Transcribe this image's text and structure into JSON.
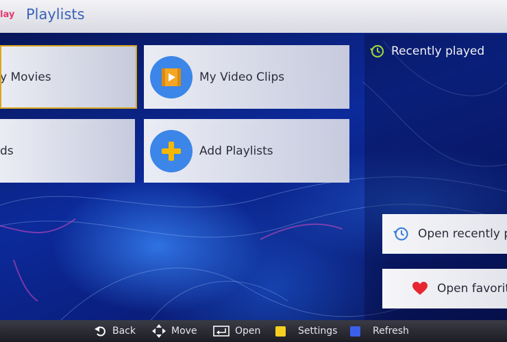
{
  "header": {
    "brand": "lay",
    "title": "Playlists"
  },
  "tiles": [
    {
      "label": "y Movies"
    },
    {
      "label": "My Video Clips"
    },
    {
      "label": "ds"
    },
    {
      "label": "Add Playlists"
    }
  ],
  "recent": {
    "title": "Recently played",
    "open_recent": "Open recently p",
    "open_favorites": "Open favorit"
  },
  "footer": {
    "back": "Back",
    "move": "Move",
    "open": "Open",
    "settings": "Settings",
    "refresh": "Refresh"
  },
  "colors": {
    "accent_yellow": "#f5d020",
    "accent_blue": "#3b5fe8",
    "icon_blue": "#3b86e8",
    "heart_red": "#e8262f",
    "recent_green": "#9bd23c"
  }
}
